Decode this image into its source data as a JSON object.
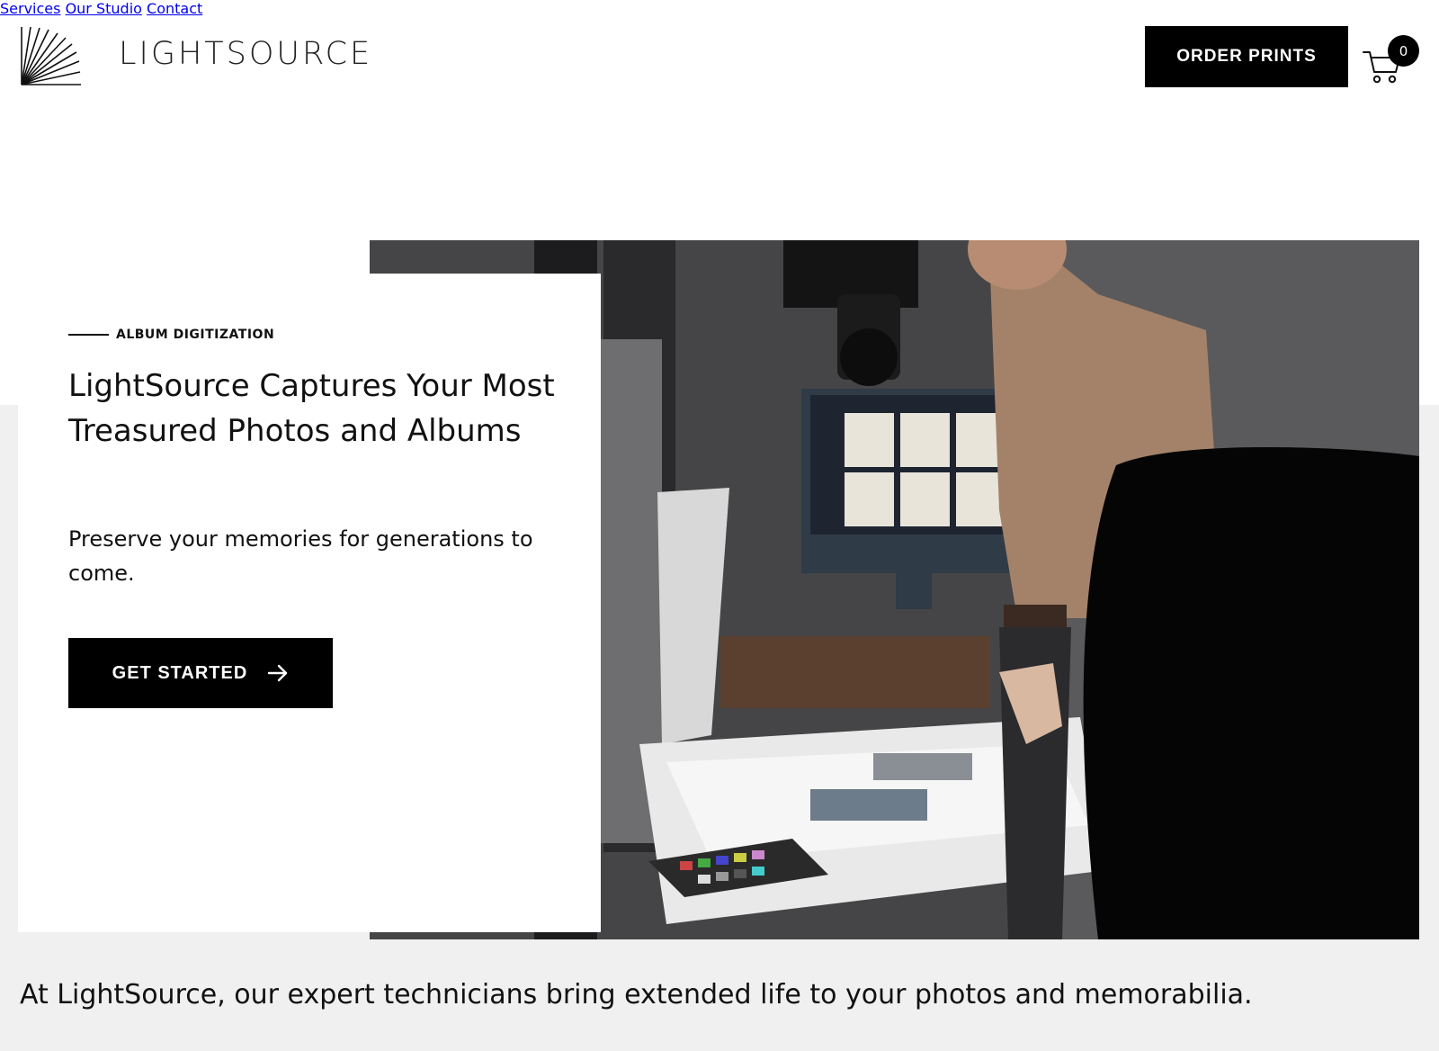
{
  "brand": {
    "name": "LIGHTSOURCE"
  },
  "nav": {
    "items": [
      {
        "label": "Services"
      },
      {
        "label": "Our Studio"
      },
      {
        "label": "Contact"
      }
    ],
    "order_label": "ORDER PRINTS",
    "cart_count": "0"
  },
  "hero": {
    "eyebrow": "ALBUM DIGITIZATION",
    "title": "LightSource Captures Your Most Treasured Photos and Albums",
    "subtitle": "Preserve your memories for generations to come.",
    "cta_label": "GET STARTED"
  },
  "intro": {
    "text": "At LightSource, our expert technicians bring extended life to your photos and memorabilia."
  },
  "colors": {
    "primary": "#000000",
    "background": "#ffffff",
    "band": "#f0f0f0"
  },
  "icons": [
    "logo-rays-icon",
    "cart-icon",
    "arrow-right-icon"
  ]
}
